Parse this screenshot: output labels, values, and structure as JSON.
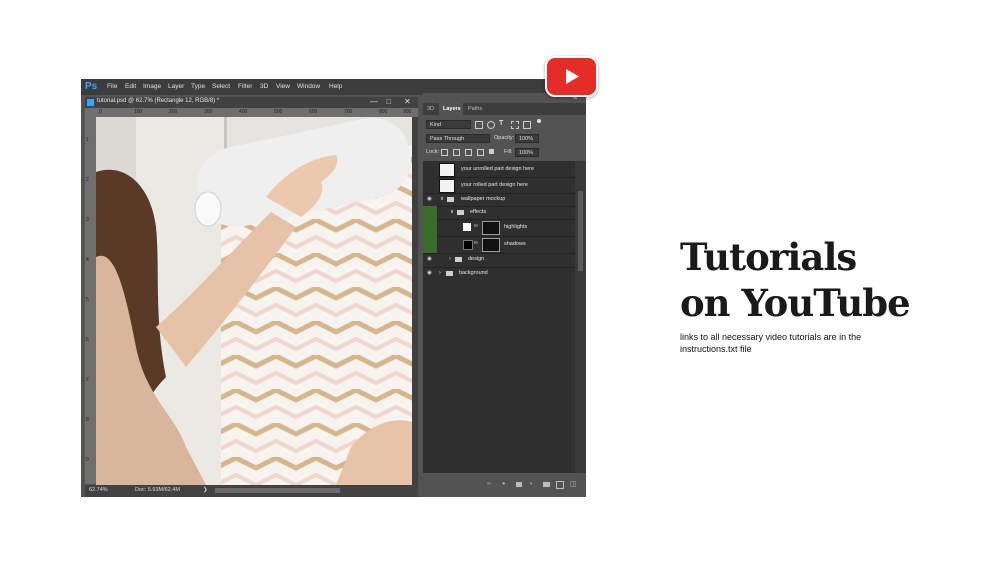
{
  "app": {
    "logo": "Ps",
    "menu": [
      "File",
      "Edit",
      "Image",
      "Layer",
      "Type",
      "Select",
      "Filter",
      "3D",
      "View",
      "Window",
      "Help"
    ],
    "document_tab": "tutorial.psd @ 62.7% (Rectangle 12, RGB/8) *",
    "window_controls": [
      "—",
      "□",
      "✕"
    ],
    "ruler_top": [
      "0",
      "100",
      "200",
      "300",
      "400",
      "500",
      "600",
      "700",
      "800",
      "900"
    ],
    "ruler_left": [
      "1",
      "2",
      "3",
      "4",
      "5",
      "6",
      "7",
      "8",
      "9"
    ],
    "status": {
      "zoom": "62.74%",
      "doc": "Doc: 5.93M/62.4M",
      "arrow": "❯"
    }
  },
  "panel": {
    "tabs": [
      "3D",
      "Layers",
      "Paths"
    ],
    "menu_icon": "≡",
    "kind_label": "Kind",
    "blend_mode": "Pass Through",
    "opacity_label": "Opacity:",
    "opacity_value": "100%",
    "lock_label": "Lock:",
    "fill_label": "Fill:",
    "fill_value": "100%",
    "layers": [
      {
        "name": "your unrolled part design here",
        "visible": false
      },
      {
        "name": "your rolled part design here",
        "visible": false
      },
      {
        "name": "wallpaper mockup",
        "visible": true
      },
      {
        "name": "effects",
        "visible": true
      },
      {
        "name": "highlights",
        "visible": true
      },
      {
        "name": "shadows",
        "visible": true
      },
      {
        "name": "design",
        "visible": true
      },
      {
        "name": "background",
        "visible": true
      }
    ]
  },
  "promo": {
    "heading_line1": "Tutorials",
    "heading_line2": "on YouTube",
    "subtext": "links to all necessary video tutorials are in the instructions.txt file"
  },
  "colors": {
    "youtube_red": "#e52d27",
    "ps_blue": "#31a8ff",
    "eye_green": "#3c6b2e"
  },
  "icons": [
    "youtube-play-icon",
    "eye-icon",
    "folder-icon",
    "chevron-icon",
    "link-icon",
    "trash-icon",
    "new-layer-icon"
  ]
}
